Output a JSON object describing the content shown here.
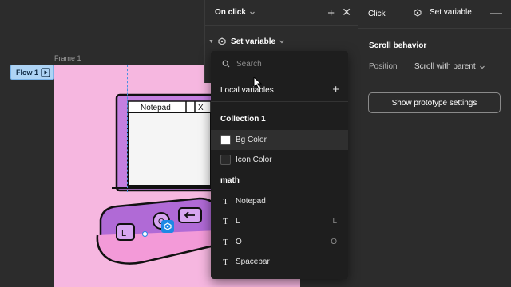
{
  "canvas": {
    "frame_label": "Frame 1",
    "flow_label": "Flow 1",
    "frame_bg": "#f6b7e0",
    "notepad_title": "Notepad",
    "notepad_close": "X",
    "key_left": "L",
    "key_o": "O"
  },
  "interaction": {
    "trigger": "On click",
    "action": "Set variable"
  },
  "props": {
    "trigger": "Click",
    "action": "Set variable",
    "section_title": "Scroll behavior",
    "position_label": "Position",
    "position_value": "Scroll with parent",
    "proto_button": "Show prototype settings"
  },
  "dropdown": {
    "search_placeholder": "Search",
    "local_variables": "Local variables",
    "items": [
      {
        "kind": "header",
        "label": "Collection 1"
      },
      {
        "kind": "color",
        "label": "Bg Color",
        "swatch": "#ffffff",
        "highlighted": true
      },
      {
        "kind": "color",
        "label": "Icon Color",
        "swatch": "#2a2a2a"
      },
      {
        "kind": "header",
        "label": "math"
      },
      {
        "kind": "text",
        "label": "Notepad",
        "value": ""
      },
      {
        "kind": "text",
        "label": "L",
        "value": "L"
      },
      {
        "kind": "text",
        "label": "O",
        "value": "O"
      },
      {
        "kind": "text",
        "label": "Spacebar",
        "value": ""
      }
    ]
  },
  "colors": {
    "accent": "#1e88e5",
    "panel": "#2c2c2c",
    "dropdown": "#1e1e1e"
  }
}
